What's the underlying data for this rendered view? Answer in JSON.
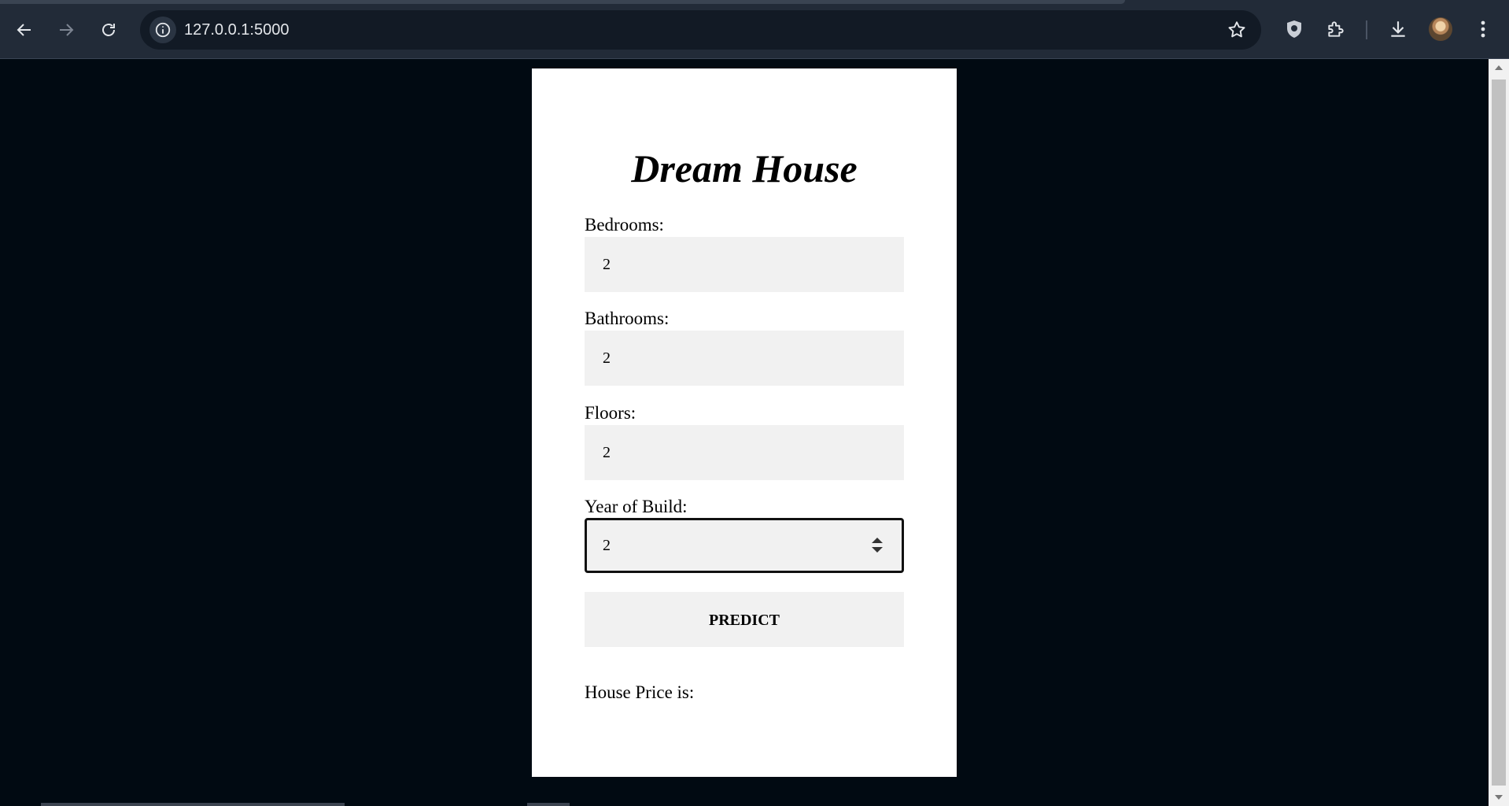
{
  "browser": {
    "url": "127.0.0.1:5000",
    "icons": [
      "back-arrow-icon",
      "forward-arrow-icon",
      "reload-icon",
      "site-info-icon",
      "bookmark-star-icon",
      "shield-extension-icon",
      "extensions-puzzle-icon",
      "download-icon",
      "profile-avatar",
      "more-menu-icon"
    ]
  },
  "page": {
    "title": "Dream House",
    "fields": [
      {
        "label": "Bedrooms:",
        "value": "2"
      },
      {
        "label": "Bathrooms:",
        "value": "2"
      },
      {
        "label": "Floors:",
        "value": "2"
      },
      {
        "label": "Year of Build:",
        "value": "2"
      }
    ],
    "predict_label": "PREDICT",
    "result_label": "House Price is:"
  },
  "colors": {
    "page_background": "#010a12",
    "card_background": "#ffffff",
    "input_background": "#f1f1f1",
    "chrome_background": "#222b38"
  }
}
